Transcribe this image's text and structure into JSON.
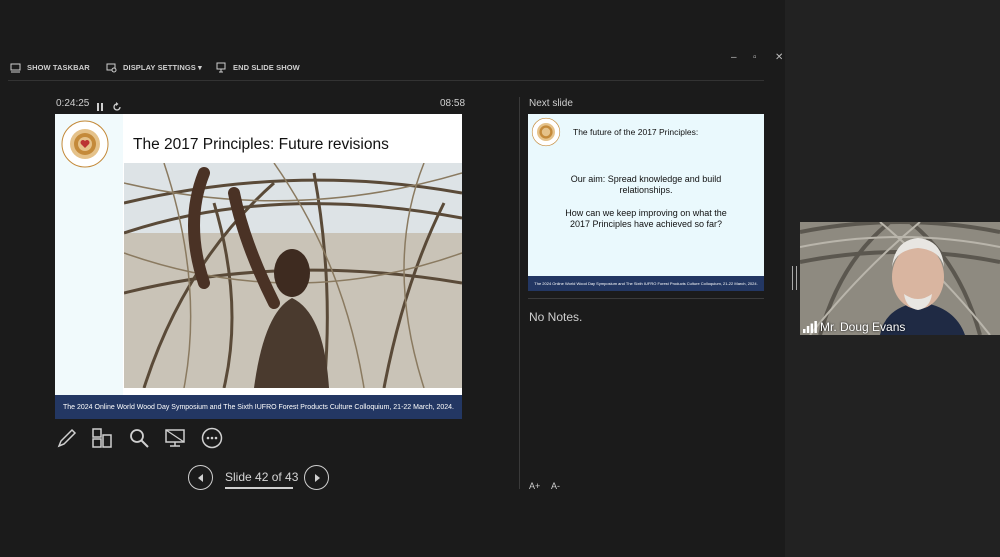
{
  "toolbar": {
    "show_taskbar": "SHOW TASKBAR",
    "display_settings": "DISPLAY SETTINGS ▾",
    "end_slide_show": "END SLIDE SHOW"
  },
  "window_controls": {
    "minimize": "–",
    "restore": "▫",
    "close": "✕"
  },
  "timer": {
    "elapsed": "0:24:25",
    "clock": "08:58"
  },
  "current_slide": {
    "title": "The 2017 Principles: Future revisions",
    "footer": "The 2024 Online World Wood Day Symposium and The Sixth IUFRO Forest Products Culture Colloquium, 21-22 March, 2024."
  },
  "navigation": {
    "counter": "Slide 42 of 43"
  },
  "next_slide": {
    "label": "Next slide",
    "title": "The future of the 2017 Principles:",
    "line1": "Our aim: Spread knowledge and build",
    "line2": "relationships.",
    "line3": "How can we keep improving on what the",
    "line4": "2017 Principles have achieved so far?",
    "footer": "The 2024 Online World Wood Day Symposium and The Sixth IUFRO Forest Products Culture Colloquium, 21-22 March, 2024."
  },
  "notes": {
    "text": "No Notes."
  },
  "font_controls": {
    "increase": "A+",
    "decrease": "A-"
  },
  "participant": {
    "name": "Mr. Doug Evans"
  },
  "icons": [
    "taskbar-icon",
    "display-settings-icon",
    "end-show-icon",
    "pause-icon",
    "reset-icon",
    "pen-icon",
    "slides-grid-icon",
    "zoom-icon",
    "screen-icon",
    "more-icon",
    "prev-icon",
    "next-icon",
    "signal-icon"
  ]
}
